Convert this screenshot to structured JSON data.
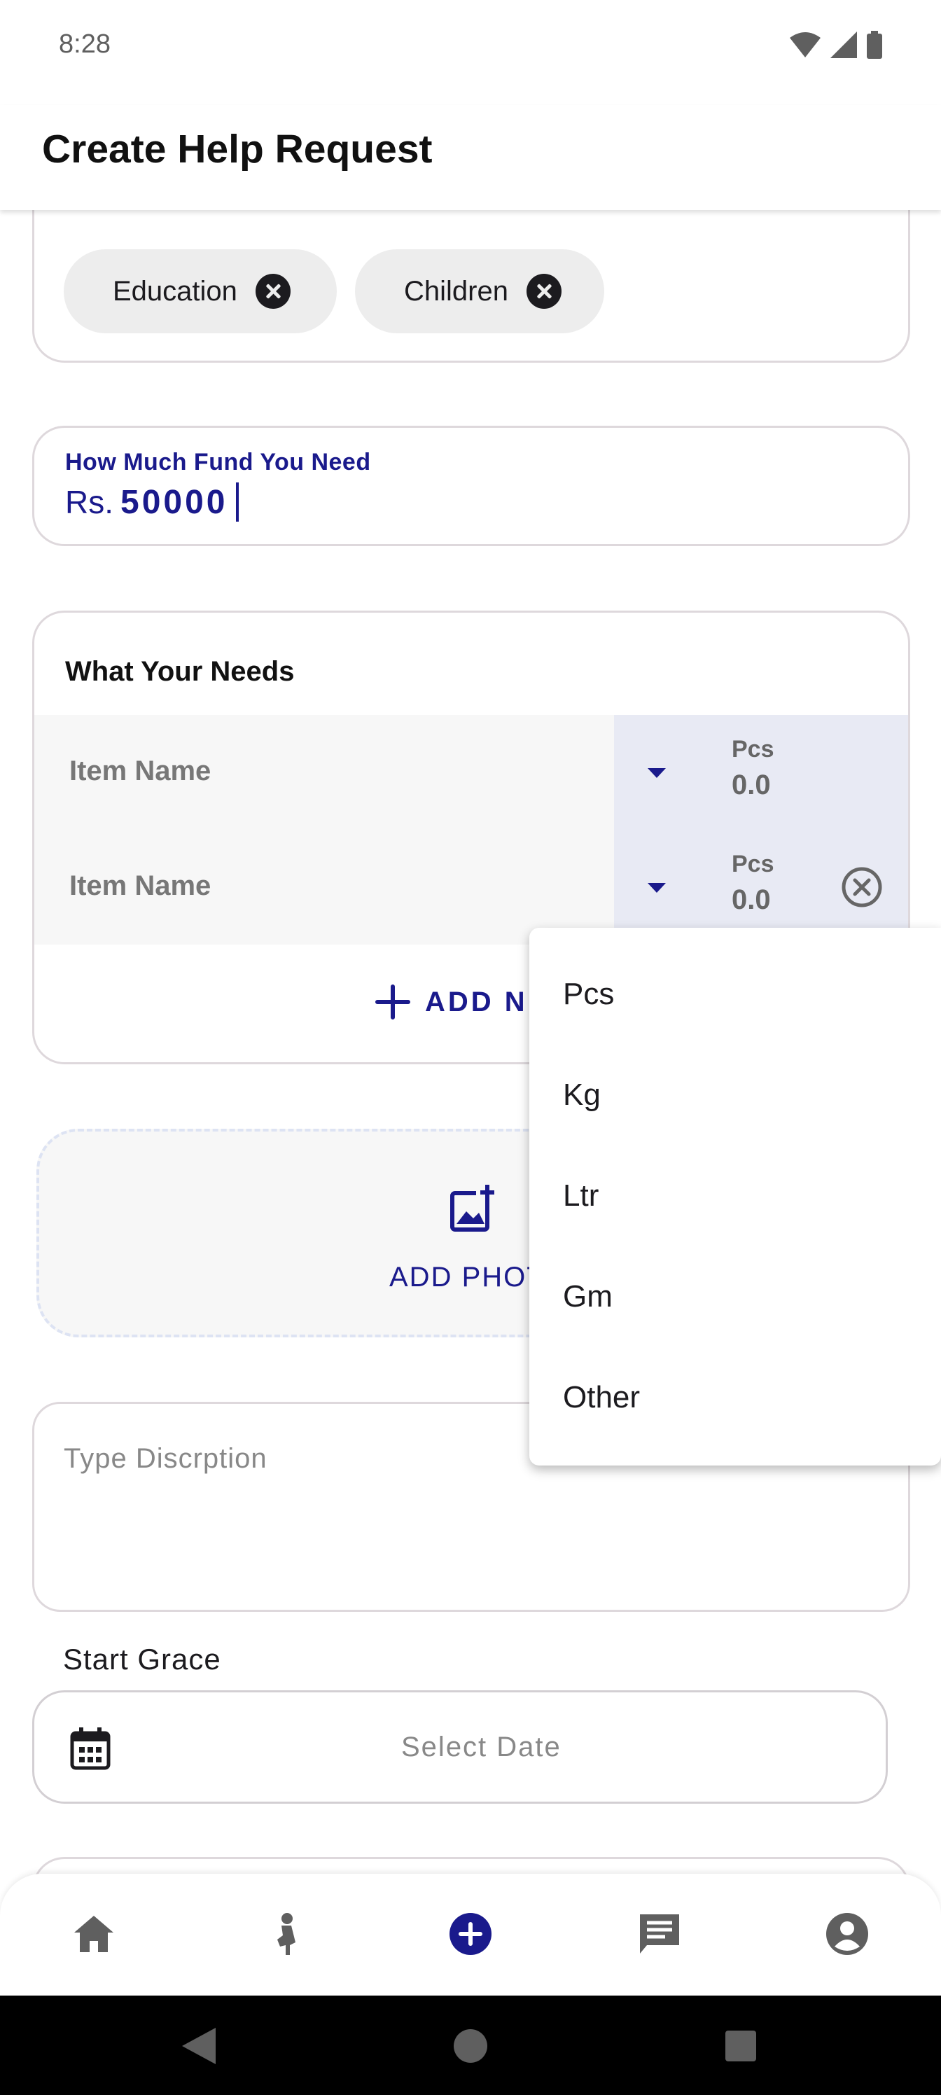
{
  "status_bar": {
    "time": "8:28"
  },
  "header": {
    "title": "Create Help Request"
  },
  "tags": [
    {
      "label": "Education"
    },
    {
      "label": "Children"
    }
  ],
  "fund": {
    "label": "How Much Fund You Need",
    "prefix": "Rs.",
    "value": "50000"
  },
  "needs": {
    "title": "What Your Needs",
    "items": [
      {
        "placeholder": "Item Name",
        "unit": "Pcs",
        "quantity": "0.0"
      },
      {
        "placeholder": "Item Name",
        "unit": "Pcs",
        "quantity": "0.0"
      }
    ],
    "add_label": "ADD NE"
  },
  "photo": {
    "label": "ADD PHOT"
  },
  "description": {
    "placeholder": "Type Discrption"
  },
  "start_grace": {
    "label": "Start Grace",
    "placeholder": "Select Date"
  },
  "unit_menu": {
    "options": [
      "Pcs",
      "Kg",
      "Ltr",
      "Gm",
      "Other"
    ]
  },
  "bottom_nav": {
    "items": [
      "home",
      "donate",
      "add",
      "messages",
      "profile"
    ],
    "active": "add"
  },
  "colors": {
    "accent": "#1a1a8c",
    "chip_bg": "#ededed",
    "unit_bg": "#e8eaf4"
  }
}
